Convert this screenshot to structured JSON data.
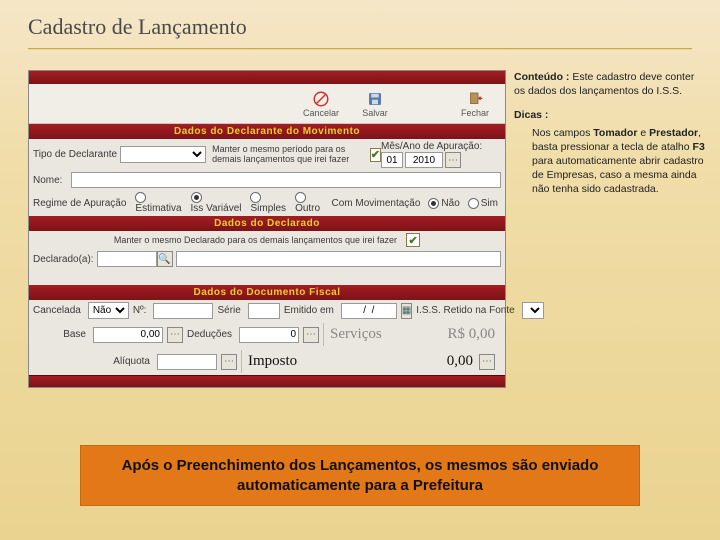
{
  "page": {
    "title": "Cadastro de Lançamento"
  },
  "toolbar": {
    "cancel": "Cancelar",
    "save": "Salvar",
    "close": "Fechar"
  },
  "sections": {
    "declarante": "Dados do Declarante do Movimento",
    "declarado": "Dados do Declarado",
    "documento": "Dados do Documento Fiscal"
  },
  "declarante": {
    "tipo_label": "Tipo de Declarante",
    "keep_period": "Manter o mesmo período para os demais lançamentos que irei fazer",
    "periodo_label": "Mês/Ano de Apuração:",
    "mes": "01",
    "ano": "2010",
    "nome_label": "Nome:",
    "regime_label": "Regime de Apuração",
    "regime_estimativa": "Estimativa",
    "regime_iss": "Iss Variável",
    "regime_simples": "Simples",
    "regime_outro": "Outro",
    "mov_label": "Com Movimentação",
    "mov_nao": "Não",
    "mov_sim": "Sim"
  },
  "declarado": {
    "keep": "Manter o mesmo Declarado para os demais lançamentos que irei fazer",
    "label": "Declarado(a):"
  },
  "documento": {
    "cancelada_label": "Cancelada",
    "cancelada_val": "Não",
    "num_label": "Nº:",
    "serie_label": "Série",
    "emitido_label": "Emitido em",
    "emitido_val": "/  /",
    "retido_label": "I.S.S. Retido na Fonte",
    "base_label": "Base",
    "base_val": "0,00",
    "deducoes_label": "Deduções",
    "deducoes_val": "0",
    "aliquota_label": "Alíquota",
    "aliquota_val": ""
  },
  "totals": {
    "servicos_label": "Serviços",
    "servicos_val": "R$ 0,00",
    "imposto_label": "Imposto",
    "imposto_val": "0,00"
  },
  "side": {
    "conteudo_title": "Conteúdo :",
    "conteudo_text": " Este cadastro deve conter os dados dos lançamentos do I.S.S.",
    "dicas_title": "Dicas :",
    "dicas_pre": "Nos campos ",
    "dicas_b1": "Tomador",
    "dicas_mid": " e ",
    "dicas_b2": "Prestador",
    "dicas_post": ", basta pressionar a tecla de atalho ",
    "dicas_b3": "F3",
    "dicas_tail": " para automaticamente abrir cadastro de Empresas, caso a mesma ainda não tenha sido cadastrada."
  },
  "callout": "Após o Preenchimento dos Lançamentos, os mesmos são enviado automaticamente para a Prefeitura"
}
